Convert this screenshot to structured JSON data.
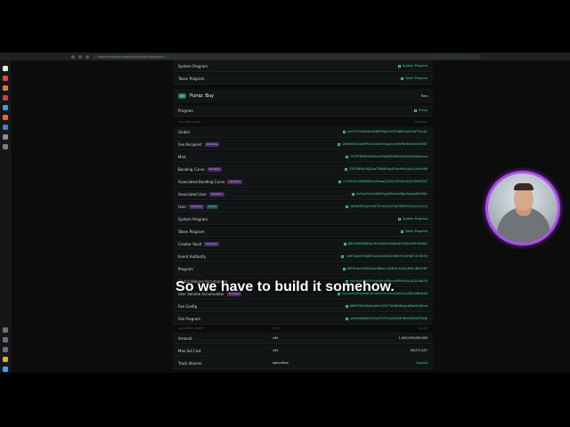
{
  "browser": {
    "url": "explorer.solana.com/tx/pumpfun?signature=..."
  },
  "caption": "So we have to build it somehow.",
  "accounts_top": [
    {
      "name": "System Program",
      "value": "System Program"
    },
    {
      "name": "Token Program",
      "value": "Token Program"
    }
  ],
  "instruction": {
    "number": "#3",
    "title": "Pump: Buy",
    "raw_label": "Raw"
  },
  "program_row": {
    "name": "Program",
    "value": "Pump"
  },
  "accounts_header": {
    "left": "ACCOUNT NAME",
    "right": "ADDRESS"
  },
  "accounts": [
    {
      "name": "Global",
      "badges": [],
      "value": "4wTV1YmiEkWvAEttRPi9gGHZ9YdBkPsoVK9zjTTkuNy"
    },
    {
      "name": "Fee Recipient",
      "badges": [
        "Writable"
      ],
      "value": "CebN5WGQ4jvEPvsVU4EoHEpgznyQHeP8hBxKw5vKDMT"
    },
    {
      "name": "Mint",
      "badges": [],
      "value": "7YVPFWPWYzRsKuLiR5pNGEbMj3eEeZmJ3t3bpump"
    },
    {
      "name": "Bonding Curve",
      "badges": [
        "Writable"
      ],
      "value": "3TKGWRo1WjJDasTRbJ6RQq4EmkN9SvJnLvCAoFn8d"
    },
    {
      "name": "Associated Bonding Curve",
      "badges": [
        "Writable"
      ],
      "value": "CuTKexZrVMENRKn4dYsawQQ5QYZETpKGfQh1fNMG9rF"
    },
    {
      "name": "Associated User",
      "badges": [
        "Writable"
      ],
      "value": "9eFsAGkyH1ANSEyjJaMmEvtD8pXtwJhjdDrt5Bh"
    },
    {
      "name": "User",
      "badges": [
        "Writable",
        "Signer"
      ],
      "value": "2bDsEGEoQXnG4TZ7mSa1STdJTXMRrGCaQuY1nCp"
    },
    {
      "name": "System Program",
      "badges": [],
      "value": "System Program"
    },
    {
      "name": "Token Program",
      "badges": [],
      "value": "Token Program"
    },
    {
      "name": "Creator Vault",
      "badges": [
        "Writable"
      ],
      "value": "BB4nMN5M8Rq13N7bkNSa2fA8sdEVGNsf5ZEf2NtNQ"
    },
    {
      "name": "Event Authority",
      "badges": [],
      "value": "Ce6TQqeHC9p8fE3wdLXvWsZnH8bYV1eHBE7xV4N7N"
    },
    {
      "name": "Program",
      "badges": [],
      "value": "6EF8rrecthR5Dkzon8Nwu78hRvfCKubJ14M5uBEwF6P"
    },
    {
      "name": "Global Volume Accumulator",
      "badges": [],
      "value": "Hq2wp8uJ9jCPsYgNHex8RtqdvMPfc5JrAuJQ2kTaaZH"
    },
    {
      "name": "User Volume Accumulator",
      "badges": [
        "Writable"
      ],
      "value": "5Qnxe9xZR4gbWDoCqDXk9FmXNb3AJ5nvy4Rp3NRzd4N"
    },
    {
      "name": "Fee Config",
      "badges": [],
      "value": "8Wf5TiMUz8p9vJ6eFq7W7TwNBNWq4nBXqf4hNVnd"
    },
    {
      "name": "Fee Program",
      "badges": [],
      "value": "pfeeUxB6jkeY1Hxd7CsFCAjcbHA9rWtchMGdZ6VojK"
    }
  ],
  "args_header": {
    "left": "ARGUMENT NAME",
    "mid": "TYPE",
    "right": "VALUE"
  },
  "args": [
    {
      "name": "Amount",
      "type": "u64",
      "value": "1,000,000,000,000"
    },
    {
      "name": "Max Sol Cost",
      "type": "u64",
      "value": "28,071,557"
    },
    {
      "name": "Track Volume",
      "type": "optionBool",
      "value": "Expand"
    }
  ],
  "colors": {
    "accent": "#3fd6a8",
    "writable_badge": "#4a2a66",
    "signer_badge": "#1c4a4a",
    "cam_ring": "#b44cf0"
  }
}
